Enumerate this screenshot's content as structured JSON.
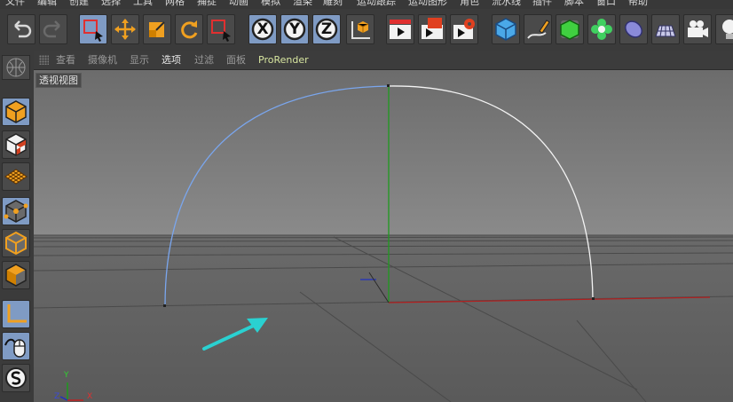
{
  "menubar": {
    "items": [
      "文件",
      "编辑",
      "创建",
      "选择",
      "工具",
      "网格",
      "捕捉",
      "动画",
      "模拟",
      "渲染",
      "雕刻",
      "运动跟踪",
      "运动图形",
      "角色",
      "流水线",
      "插件",
      "脚本",
      "窗口",
      "帮助"
    ]
  },
  "toolbar": {
    "axis_x": "X",
    "axis_y": "Y",
    "axis_z": "Z"
  },
  "viewport": {
    "menu": [
      "查看",
      "摄像机",
      "显示",
      "选项",
      "过滤",
      "面板",
      "ProRender"
    ],
    "active_menu": "选项",
    "label": "透视视图",
    "axis_gizmo": {
      "y": "Y",
      "z": "Z",
      "x": "X"
    }
  },
  "colors": {
    "accent_select": "#7f9bc4",
    "arrow_annotation": "#2ad1d1",
    "axis_red": "#b02020",
    "axis_green": "#1e9a1e",
    "axis_blue": "#2030c0"
  }
}
